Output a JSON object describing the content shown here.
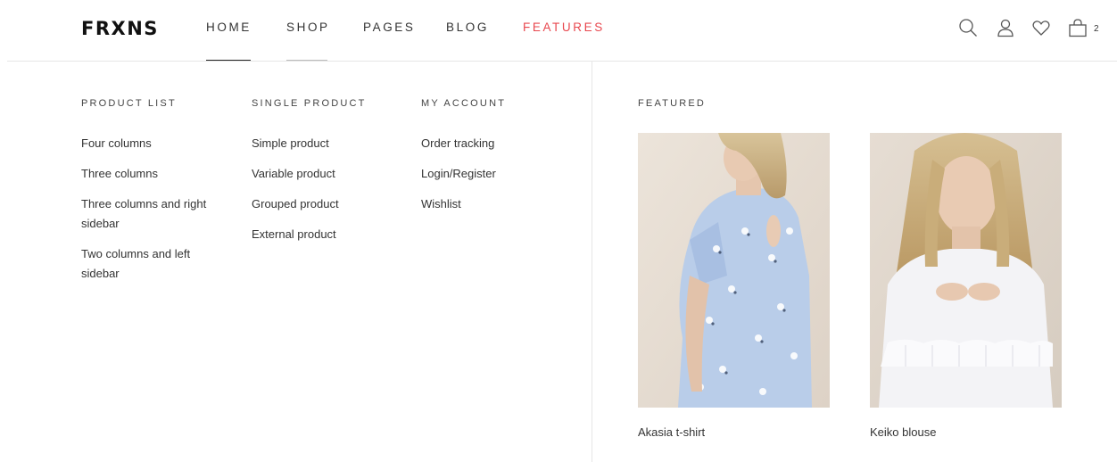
{
  "header": {
    "logo": "FRXNS",
    "nav": [
      {
        "label": "HOME",
        "active": false
      },
      {
        "label": "SHOP",
        "active": false
      },
      {
        "label": "PAGES",
        "active": false
      },
      {
        "label": "BLOG",
        "active": false
      },
      {
        "label": "FEATURES",
        "active": true
      }
    ],
    "icons": [
      "search-icon",
      "user-icon",
      "heart-icon",
      "bag-icon"
    ],
    "cart_count": "2",
    "active_color": "#e8484f"
  },
  "mega_menu": {
    "columns": [
      {
        "title": "PRODUCT LIST",
        "items": [
          "Four columns",
          "Three columns",
          "Three columns and right sidebar",
          "Two columns and left sidebar"
        ]
      },
      {
        "title": "SINGLE PRODUCT",
        "items": [
          "Simple product",
          "Variable product",
          "Grouped product",
          "External product"
        ]
      },
      {
        "title": "MY ACCOUNT",
        "items": [
          "Order tracking",
          "Login/Register",
          "Wishlist"
        ]
      }
    ],
    "featured": {
      "title": "FEATURED",
      "products": [
        {
          "name": "Akasia t-shirt"
        },
        {
          "name": "Keiko blouse"
        }
      ]
    }
  }
}
